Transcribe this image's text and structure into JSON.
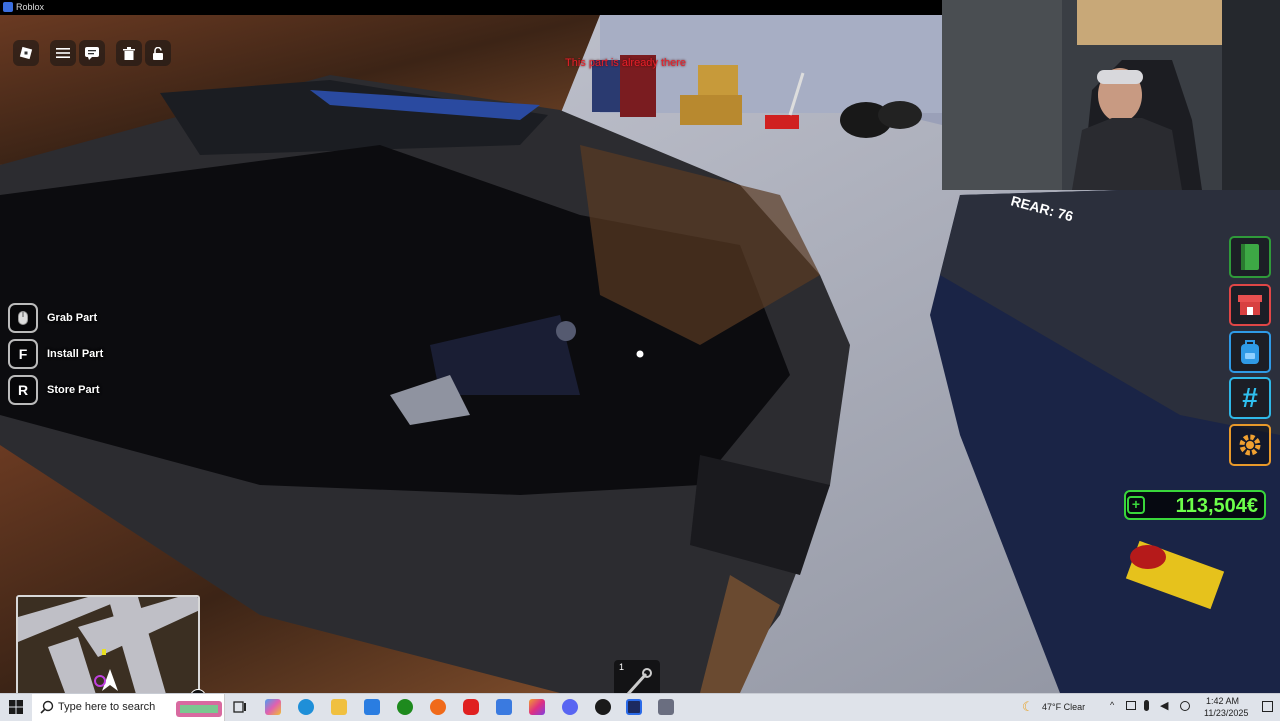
{
  "window": {
    "title": "Roblox"
  },
  "status_message": "This part is already there",
  "interaction_hints": [
    {
      "key": "",
      "icon": "mouse-icon",
      "label": "Grab Part"
    },
    {
      "key": "F",
      "label": "Install Part"
    },
    {
      "key": "R",
      "label": "Store Part"
    }
  ],
  "currency": {
    "amount": "113,504€",
    "plus": "+"
  },
  "side_menu": [
    {
      "name": "book-button",
      "icon": "book-icon",
      "color": "#2f9a3a"
    },
    {
      "name": "shop-button",
      "icon": "shop-icon",
      "color": "#e04646"
    },
    {
      "name": "backpack-button",
      "icon": "backpack-icon",
      "color": "#2f9ae6"
    },
    {
      "name": "hashtag-button",
      "icon": "hashtag-icon",
      "color": "#2fb8e8"
    },
    {
      "name": "settings-button",
      "icon": "gear-icon",
      "color": "#e8992a"
    }
  ],
  "hotbar": {
    "slot_number": "1"
  },
  "minimap": {
    "compass": "N"
  },
  "scene_text": {
    "plate": "REAR: 76"
  },
  "taskbar": {
    "search_placeholder": "Type here to search",
    "weather": "47°F  Clear",
    "time": "1:42 AM",
    "date": "11/23/2025"
  }
}
